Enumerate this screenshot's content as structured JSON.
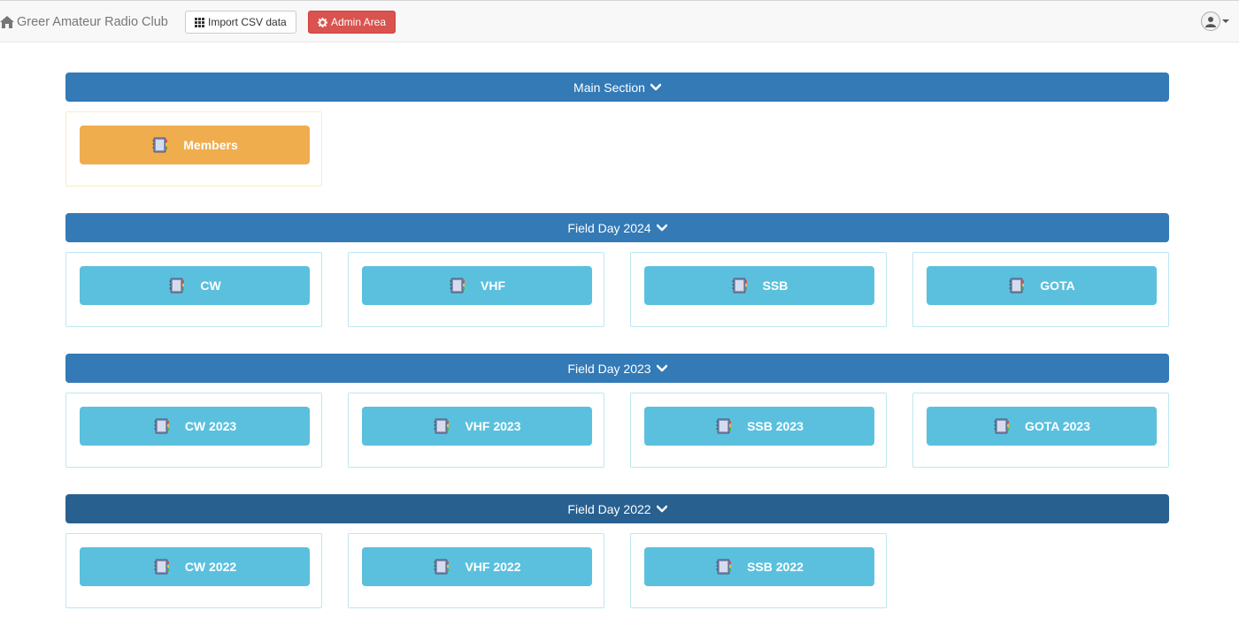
{
  "navbar": {
    "brand": "Greer Amateur Radio Club",
    "import_label": "Import CSV data",
    "admin_label": "Admin Area"
  },
  "sections": [
    {
      "title": "Main Section",
      "items": [
        "Members"
      ]
    },
    {
      "title": "Field Day 2024",
      "items": [
        "CW",
        "VHF",
        "SSB",
        "GOTA"
      ]
    },
    {
      "title": "Field Day 2023",
      "items": [
        "CW 2023",
        "VHF 2023",
        "SSB 2023",
        "GOTA 2023"
      ]
    },
    {
      "title": "Field Day 2022",
      "items": [
        "CW 2022",
        "VHF 2022",
        "SSB 2022"
      ]
    }
  ],
  "colors": {
    "primary": "#337ab7",
    "primary_active": "#286090",
    "info": "#5bc0de",
    "warning": "#f0ad4e",
    "danger": "#d9534f"
  },
  "icons": [
    "home-icon",
    "grid-icon",
    "gear-icon",
    "user-icon",
    "chevron-down-icon",
    "notebook-icon"
  ]
}
